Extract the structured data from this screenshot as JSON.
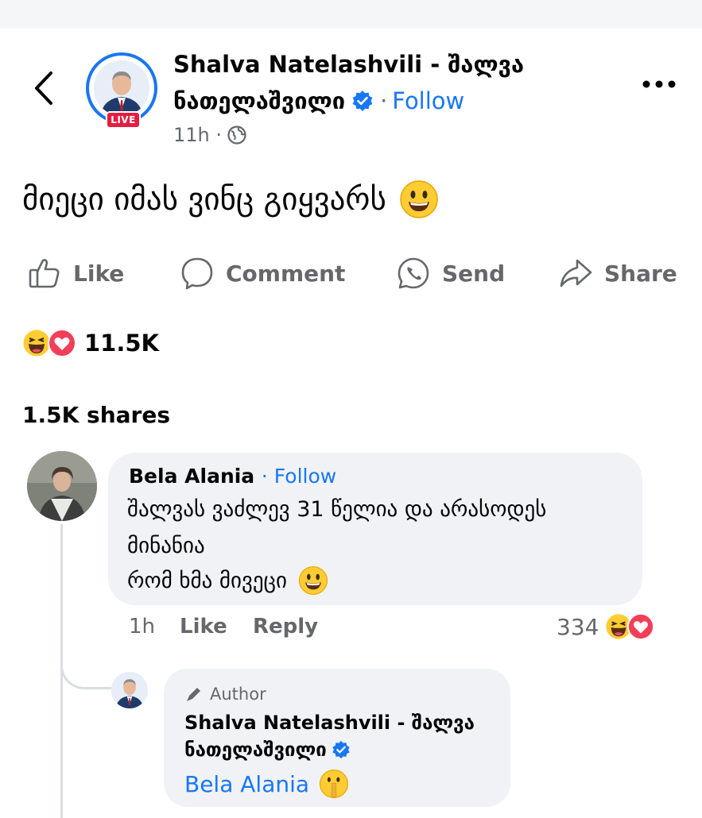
{
  "header": {
    "author_line1": "Shalva Natelashvili -  შალვა",
    "author_line2": "ნათელაშვილი",
    "separator": "·",
    "follow_label": "Follow",
    "live_badge": "LIVE",
    "time": "11h ·"
  },
  "post": {
    "text": "მიეცი იმას ვინც გიყვარს"
  },
  "actions": {
    "like": "Like",
    "comment": "Comment",
    "send": "Send",
    "share": "Share"
  },
  "stats": {
    "reactions_count": "11.5K",
    "shares": "1.5K shares"
  },
  "comment": {
    "name": "Bela Alania",
    "follow": "· Follow",
    "line1": "შალვას ვაძლევ 31 წელია და არასოდეს",
    "line2": "მინანია",
    "line3": "რომ ხმა მივეცი",
    "time": "1h",
    "like": "Like",
    "reply": "Reply",
    "reaction_count": "334"
  },
  "reply": {
    "badge": "Author",
    "name_line1": "Shalva Natelashvili -  შალვა",
    "name_line2": "ნათელაშვილი",
    "mention": "Bela Alania"
  },
  "colors": {
    "accent": "#1877f2",
    "live": "#e41e3f",
    "muted": "#65676b",
    "bubble": "#f0f2f5"
  },
  "icons": [
    "back-chevron-icon",
    "verified-badge-icon",
    "globe-icon",
    "more-options-icon",
    "like-thumb-icon",
    "comment-bubble-icon",
    "send-messenger-icon",
    "share-arrow-icon",
    "haha-reaction-icon",
    "love-reaction-icon",
    "pen-author-icon",
    "smiley-emoji-icon",
    "shushing-emoji-icon"
  ]
}
